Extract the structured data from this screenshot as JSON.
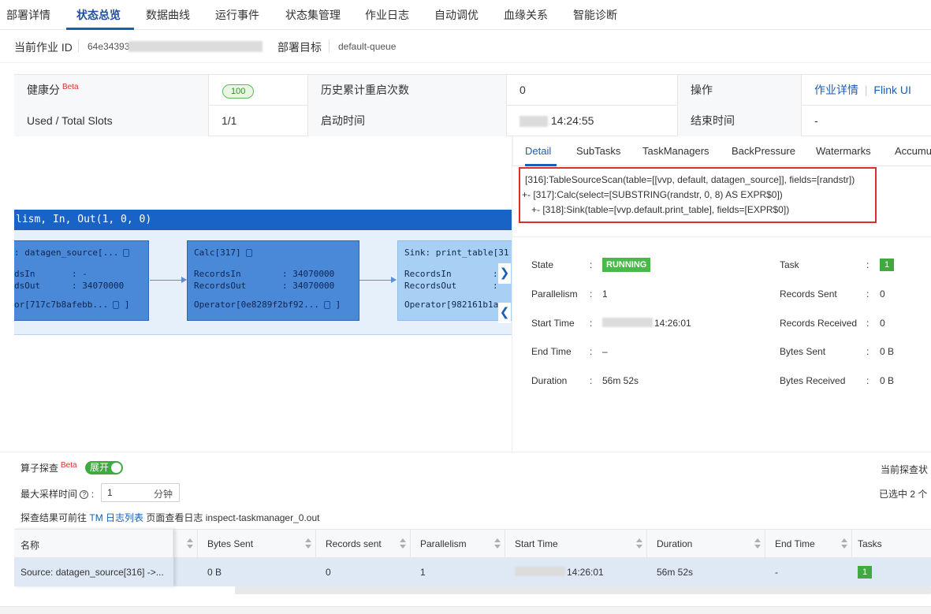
{
  "nav": {
    "tabs": [
      {
        "label": "部署详情"
      },
      {
        "label": "状态总览"
      },
      {
        "label": "数据曲线"
      },
      {
        "label": "运行事件"
      },
      {
        "label": "状态集管理"
      },
      {
        "label": "作业日志"
      },
      {
        "label": "自动调优"
      },
      {
        "label": "血缘关系"
      },
      {
        "label": "智能诊断"
      }
    ],
    "active": "状态总览"
  },
  "job": {
    "id_label": "当前作业 ID",
    "id_value": "64e34393",
    "target_label": "部署目标",
    "target_value": "default-queue"
  },
  "summary": {
    "health_label": "健康分",
    "health_beta": "Beta",
    "health_value": "100",
    "restarts_label": "历史累计重启次数",
    "restarts_value": "0",
    "ops_label": "操作",
    "link_detail": "作业详情",
    "link_flink": "Flink UI",
    "slots_label": "Used / Total Slots",
    "slots_value": "1/1",
    "start_label": "启动时间",
    "start_value": "14:24:55",
    "end_label": "结束时间",
    "end_value": "-"
  },
  "graph": {
    "header": "lism, In, Out(1, 0, 0)",
    "nodes": [
      {
        "title": ": datagen_source[...",
        "in_label": "dsIn",
        "in_value": ": -",
        "out_label": "dsOut",
        "out_value": ": 34070000",
        "operator": "or[717c7b8afebb..."
      },
      {
        "title": "Calc[317]",
        "in_label": "RecordsIn",
        "in_value": ": 34070000",
        "out_label": "RecordsOut",
        "out_value": ": 34070000",
        "operator": "Operator[0e8289f2bf92..."
      },
      {
        "title": "Sink: print_table[31",
        "in_label": "RecordsIn",
        "in_value": ":",
        "out_label": "RecordsOut",
        "out_value": ":",
        "operator": "Operator[982161b1a"
      }
    ]
  },
  "detail": {
    "tabs": [
      "Detail",
      "SubTasks",
      "TaskManagers",
      "BackPressure",
      "Watermarks",
      "Accumu"
    ],
    "plan": [
      "[316]:TableSourceScan(table=[[vvp, default, datagen_source]], fields=[randstr])",
      "+- [317]:Calc(select=[SUBSTRING(randstr, 0, 8) AS EXPR$0])",
      "+- [318]:Sink(table=[vvp.default.print_table], fields=[EXPR$0])"
    ],
    "left": [
      {
        "key": "State",
        "value": "RUNNING"
      },
      {
        "key": "Parallelism",
        "value": "1"
      },
      {
        "key": "Start Time",
        "value": "14:26:01"
      },
      {
        "key": "End Time",
        "value": "–"
      },
      {
        "key": "Duration",
        "value": "56m 52s"
      }
    ],
    "right": [
      {
        "key": "Task",
        "value": "1"
      },
      {
        "key": "Records Sent",
        "value": "0"
      },
      {
        "key": "Records Received",
        "value": "0"
      },
      {
        "key": "Bytes Sent",
        "value": "0 B"
      },
      {
        "key": "Bytes Received",
        "value": "0 B"
      }
    ]
  },
  "probe": {
    "label": "算子探查",
    "beta": "Beta",
    "toggle": "展开",
    "max_time_label": "最大采样时间",
    "max_time_value": "1",
    "max_time_unit": "分钟",
    "hint_prefix": "探查结果可前往",
    "hint_link": "TM 日志列表",
    "hint_suffix": "页面查看日志 inspect-taskmanager_0.out",
    "status_right": "当前探查状",
    "selected_right": "已选中 2 个"
  },
  "table": {
    "headers": [
      "名称",
      "Bytes Sent",
      "Records sent",
      "Parallelism",
      "Start Time",
      "Duration",
      "End Time",
      "Tasks"
    ],
    "row": {
      "name": "Source: datagen_source[316] ->...",
      "bytes_sent": "0 B",
      "records_sent": "0",
      "parallelism": "1",
      "start_time": "14:26:01",
      "duration": "56m 52s",
      "end_time": "-",
      "tasks": "1"
    }
  },
  "colors": {
    "accent": "#1a5fb4",
    "running": "#4bb84b",
    "node": "#4a88d8",
    "highlight": "#d9302c"
  }
}
